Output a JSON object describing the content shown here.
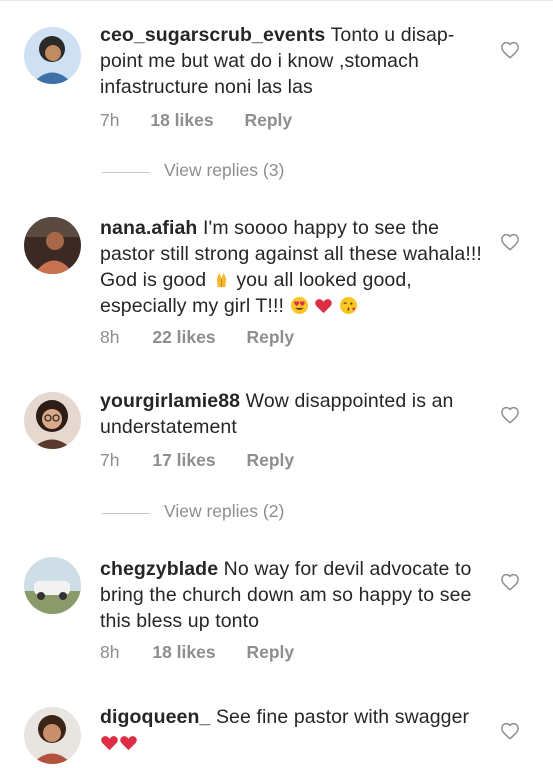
{
  "comments": [
    {
      "username": "ceo_sugarscrub_events",
      "text": "Tonto u disap-point me but wat do i know ,stomach infastructure noni las las",
      "time": "7h",
      "likes": "18 likes",
      "reply": "Reply",
      "avatar_color": "#3d6fa8"
    },
    {
      "username": "nana.afiah",
      "text": "I'm soooo happy to see the pastor still strong against all these wahala!!! God is good",
      "text_after_emoji": "you all looked good, especially my girl T!!!",
      "time": "8h",
      "likes": "22 likes",
      "reply": "Reply",
      "avatar_color": "#8a5a44"
    },
    {
      "username": "yourgirlamie88",
      "text": "Wow disappointed is an understatement",
      "time": "7h",
      "likes": "17 likes",
      "reply": "Reply",
      "avatar_color": "#5b3a2e"
    },
    {
      "username": "chegzyblade",
      "text": "No way for devil advocate to bring the church down am so happy to see this bless up tonto",
      "time": "8h",
      "likes": "18 likes",
      "reply": "Reply",
      "avatar_color": "#9fb3c0"
    },
    {
      "username": "digoqueen_",
      "text": "See fine pastor with swagger",
      "avatar_color": "#b0523c"
    }
  ],
  "view_replies": [
    {
      "label": "View replies (3)"
    },
    {
      "label": "View replies (2)"
    }
  ],
  "icons": {
    "heart": "heart-outline-icon",
    "praying": "praying-hands-emoji",
    "heart_eyes": "heart-eyes-emoji",
    "red_heart": "red-heart-emoji",
    "kiss": "face-blowing-kiss-emoji"
  },
  "colors": {
    "text": "#262626",
    "muted": "#8e8e8e",
    "heart_red": "#e0245e"
  }
}
